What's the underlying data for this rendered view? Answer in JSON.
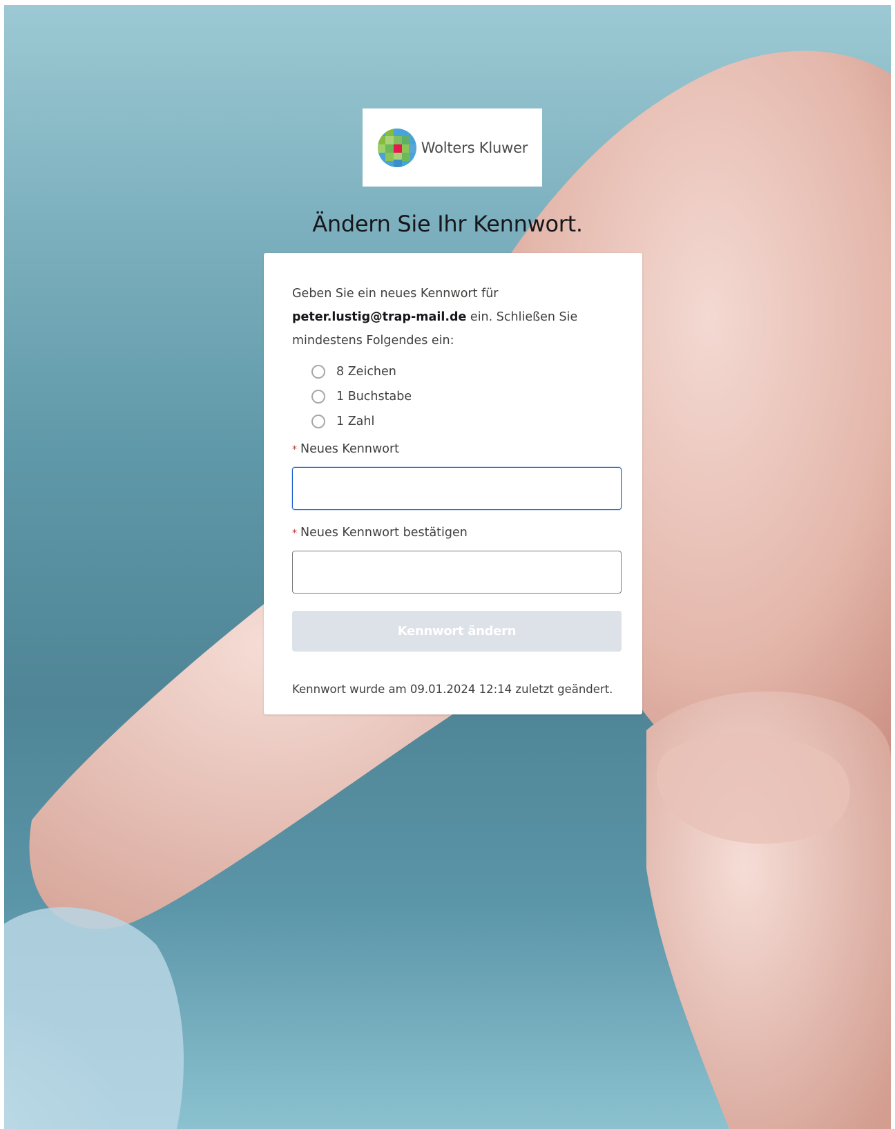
{
  "logo": {
    "brand_name": "Wolters Kluwer"
  },
  "page": {
    "heading": "Ändern Sie Ihr Kennwort."
  },
  "card": {
    "instruction_prefix": "Geben Sie ein neues Kennwort für ",
    "email": "peter.lustig@trap-mail.de",
    "instruction_suffix": " ein. Schließen Sie mindestens Folgendes ein:",
    "requirements": [
      {
        "label": "8 Zeichen"
      },
      {
        "label": "1 Buchstabe"
      },
      {
        "label": "1 Zahl"
      }
    ],
    "required_marker": "*",
    "new_password_label": "Neues Kennwort",
    "new_password_value": "",
    "confirm_password_label": "Neues Kennwort bestätigen",
    "confirm_password_value": "",
    "submit_label": "Kennwort ändern",
    "last_changed": "Kennwort wurde am 09.01.2024 12:14 zuletzt geändert."
  },
  "colors": {
    "focus_border": "#1b5fd0",
    "required_star": "#c23934",
    "button_disabled_bg": "#dde1e8"
  }
}
